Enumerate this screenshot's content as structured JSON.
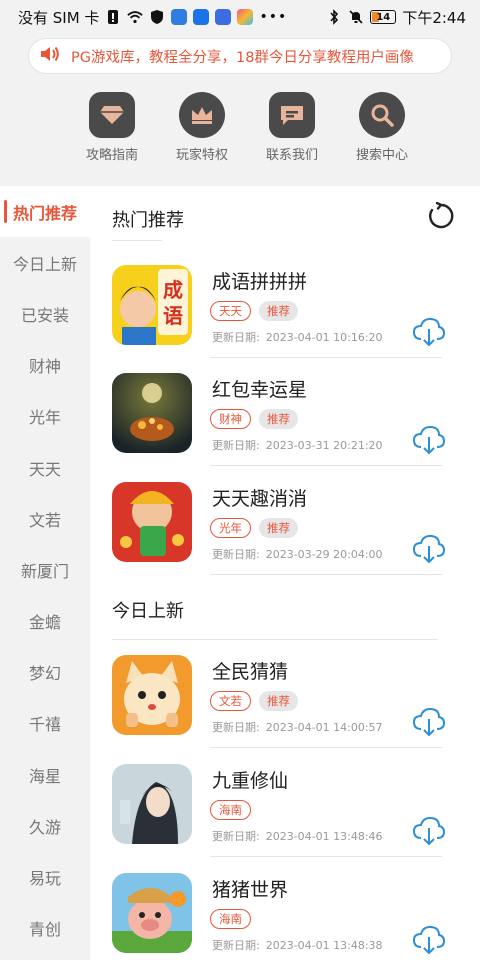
{
  "status_bar": {
    "carrier": "没有 SIM 卡",
    "battery": "14",
    "time": "下午2:44"
  },
  "notice": {
    "text": "PG游戏库，教程全分享，18群今日分享教程用户画像"
  },
  "shortcuts": [
    {
      "label": "攻略指南",
      "icon": "diamond-icon"
    },
    {
      "label": "玩家特权",
      "icon": "crown-icon"
    },
    {
      "label": "联系我们",
      "icon": "chat-icon"
    },
    {
      "label": "搜索中心",
      "icon": "search-icon"
    }
  ],
  "sidebar": {
    "items": [
      {
        "label": "热门推荐"
      },
      {
        "label": "今日上新"
      },
      {
        "label": "已安装"
      },
      {
        "label": "财神"
      },
      {
        "label": "光年"
      },
      {
        "label": "天天"
      },
      {
        "label": "文若"
      },
      {
        "label": "新厦门"
      },
      {
        "label": "金蟾"
      },
      {
        "label": "梦幻"
      },
      {
        "label": "千禧"
      },
      {
        "label": "海星"
      },
      {
        "label": "久游"
      },
      {
        "label": "易玩"
      },
      {
        "label": "青创"
      }
    ]
  },
  "sections": [
    {
      "title": "热门推荐",
      "games": [
        {
          "name": "成语拼拼拼",
          "tags": [
            "天天",
            "推荐"
          ],
          "date_label": "更新日期:",
          "date": "2023-04-01 10:16:20",
          "thumb_text": "成语"
        },
        {
          "name": "红包幸运星",
          "tags": [
            "财神",
            "推荐"
          ],
          "date_label": "更新日期:",
          "date": "2023-03-31 20:21:20"
        },
        {
          "name": "天天趣消消",
          "tags": [
            "光年",
            "推荐"
          ],
          "date_label": "更新日期:",
          "date": "2023-03-29 20:04:00"
        }
      ]
    },
    {
      "title": "今日上新",
      "games": [
        {
          "name": "全民猜猜",
          "tags": [
            "文若",
            "推荐"
          ],
          "date_label": "更新日期:",
          "date": "2023-04-01 14:00:57"
        },
        {
          "name": "九重修仙",
          "tags": [
            "海南"
          ],
          "date_label": "更新日期:",
          "date": "2023-04-01 13:48:46"
        },
        {
          "name": "猪猪世界",
          "tags": [
            "海南"
          ],
          "date_label": "更新日期:",
          "date": "2023-04-01 13:48:38"
        }
      ]
    }
  ],
  "colors": {
    "accent": "#e8563a",
    "download": "#2d8fd5"
  }
}
